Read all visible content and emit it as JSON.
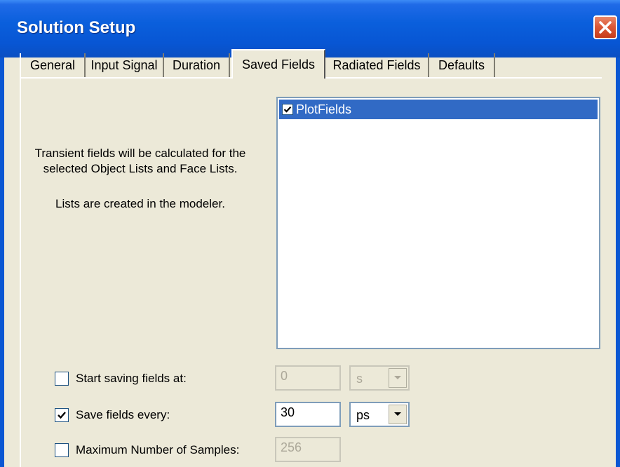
{
  "window": {
    "title": "Solution Setup",
    "close_icon": "close-icon",
    "accent_color": "#0a57d3",
    "close_color": "#dd5a38"
  },
  "tabs": [
    {
      "label": "General"
    },
    {
      "label": "Input Signal"
    },
    {
      "label": "Duration"
    },
    {
      "label": "Saved Fields",
      "active": true
    },
    {
      "label": "Radiated Fields"
    },
    {
      "label": "Defaults"
    }
  ],
  "info": {
    "line1": "Transient fields will be calculated for the",
    "line2": "selected Object Lists and Face Lists.",
    "line3": "Lists are created in the modeler."
  },
  "list": {
    "items": [
      {
        "label": "PlotFields",
        "checked": true,
        "selected": true
      }
    ]
  },
  "options": {
    "start_saving": {
      "label": "Start saving fields at:",
      "checked": false,
      "value": "0",
      "unit": "s",
      "enabled": false
    },
    "save_every": {
      "label": "Save fields every:",
      "checked": true,
      "value": "30",
      "unit": "ps",
      "enabled": true
    },
    "max_samples": {
      "label": "Maximum Number of Samples:",
      "checked": false,
      "value": "256",
      "enabled": false
    }
  }
}
